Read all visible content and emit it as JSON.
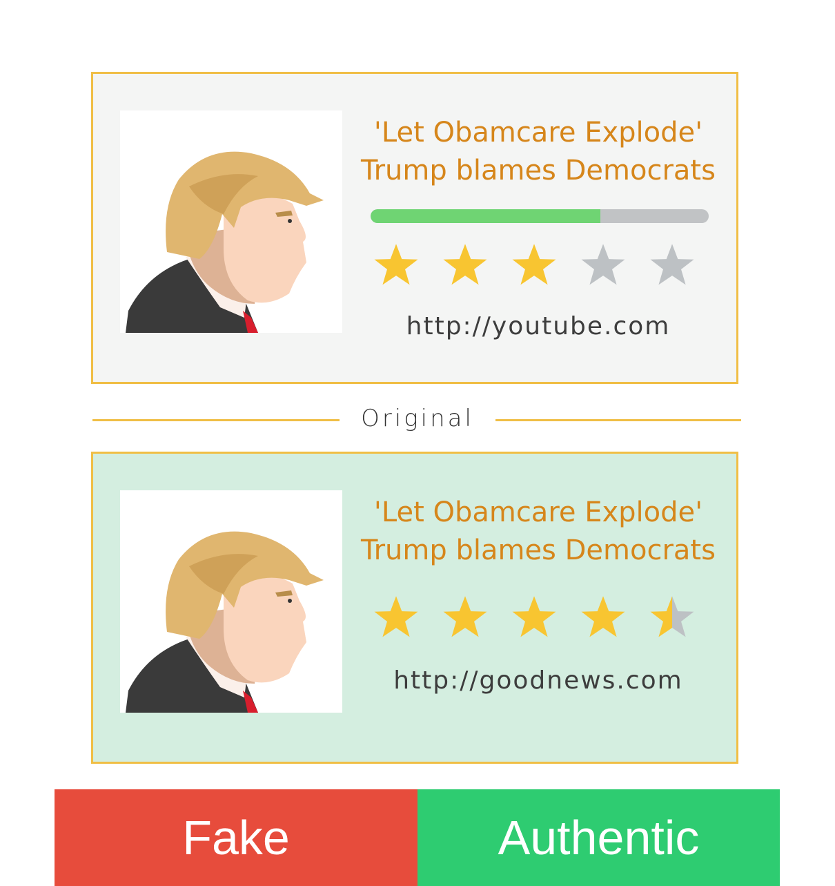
{
  "colors": {
    "border": "#f0be45",
    "headline": "#d6861b",
    "star_filled": "#f8c531",
    "star_empty": "#bdc1c4",
    "progress_fill": "#6fd473",
    "progress_track": "#c1c3c5",
    "fake": "#e74c3c",
    "authentic": "#2ecc71",
    "card_top_bg": "#f4f5f4",
    "card_bottom_bg": "#d4eee0"
  },
  "top_card": {
    "headline_line1": "'Let Obamcare Explode'",
    "headline_line2": "Trump blames Democrats",
    "credibility_fraction": 0.68,
    "star_rating": 3,
    "star_max": 5,
    "source": "http://youtube.com"
  },
  "divider": {
    "label": "Original"
  },
  "bottom_card": {
    "headline_line1": "'Let Obamcare Explode'",
    "headline_line2": "Trump blames Democrats",
    "star_rating": 4.5,
    "star_max": 5,
    "source": "http://goodnews.com"
  },
  "buttons": {
    "fake_label": "Fake",
    "authentic_label": "Authentic"
  },
  "icons": {
    "thumbnail": "cartoon-portrait-illustration",
    "star": "star-icon"
  }
}
